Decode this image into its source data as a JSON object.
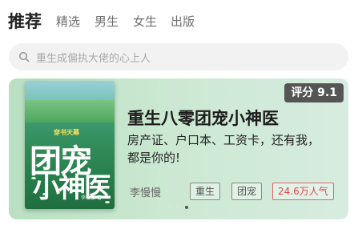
{
  "tabs": [
    {
      "label": "推荐",
      "active": true
    },
    {
      "label": "精选",
      "active": false
    },
    {
      "label": "男生",
      "active": false
    },
    {
      "label": "女生",
      "active": false
    },
    {
      "label": "出版",
      "active": false
    }
  ],
  "search": {
    "placeholder": "重生成偏执大佬的心上人",
    "icon": "search-icon"
  },
  "featured_book": {
    "cover": {
      "series_tag": "穿书天幕",
      "title_line1": "团宠",
      "title_line2": "小神医",
      "author": "李慢慢 著"
    },
    "score": "评分 9.1",
    "title": "重生八零团宠小神医",
    "description": "房产证、户口本、工资卡，还有我，都是你的!",
    "author": "李慢慢",
    "tags": [
      "重生",
      "团宠"
    ],
    "popularity": "24.6万人气",
    "colors": {
      "score_bg": "#555555",
      "popularity": "#d84a4a",
      "card_bg": "#cbe8d1"
    }
  },
  "carousel": {
    "count": 3,
    "active_index": 2
  }
}
